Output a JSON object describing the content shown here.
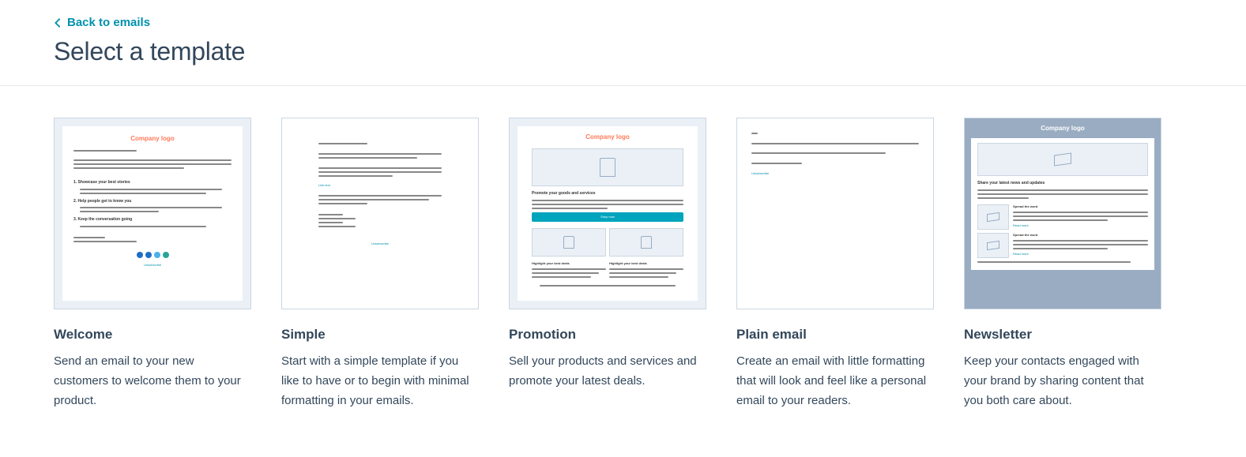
{
  "header": {
    "back_label": "Back to emails",
    "title": "Select a template"
  },
  "templates": [
    {
      "id": "welcome",
      "title": "Welcome",
      "description": "Send an email to your new customers to welcome them to your product."
    },
    {
      "id": "simple",
      "title": "Simple",
      "description": "Start with a simple template if you like to have or to begin with minimal formatting in your emails."
    },
    {
      "id": "promotion",
      "title": "Promotion",
      "description": "Sell your products and services and promote your latest deals."
    },
    {
      "id": "plain",
      "title": "Plain email",
      "description": "Create an email with little formatting that will look and feel like a personal email to your readers."
    },
    {
      "id": "newsletter",
      "title": "Newsletter",
      "description": "Keep your contacts engaged with your brand by sharing content that you both care about."
    }
  ],
  "preview": {
    "company_logo": "Company logo",
    "promote_heading": "Promote your goods and services",
    "highlight_heading": "Highlight your best deals",
    "shop_now": "Shop now",
    "newsletter_heading": "Share your latest news and updates",
    "spread_word": "Spread the word",
    "read_more": "Read more",
    "unsubscribe": "Unsubscribe"
  }
}
